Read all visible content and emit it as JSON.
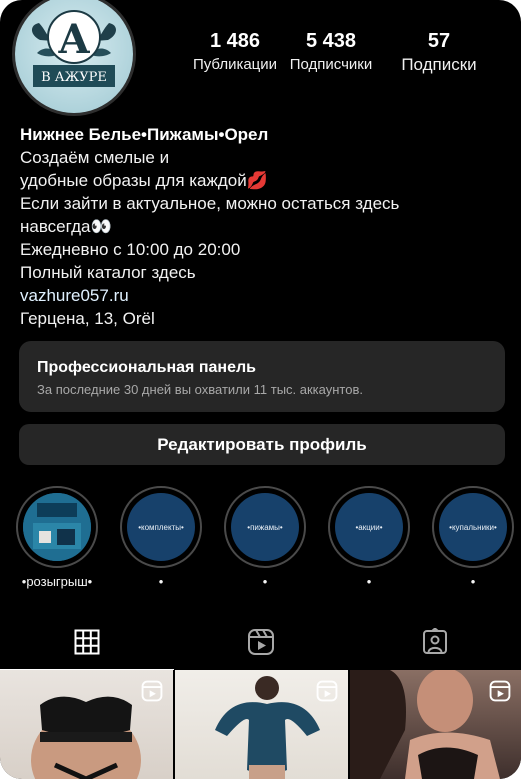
{
  "profile": {
    "logo_text": "В АЖУРЕ",
    "stats": [
      {
        "value": "1 486",
        "label": "Публикации"
      },
      {
        "value": "5 438",
        "label": "Подписчики"
      },
      {
        "value": "57",
        "label": "Подписки"
      }
    ],
    "bio": {
      "name": "Нижнее Белье•Пижамы•Орел",
      "line1": "Создаём смелые и",
      "line2": "удобные образы для каждой💋",
      "line3": "Если зайти в актуальное, можно остаться здесь",
      "line4": "навсегда👀",
      "line5": "Ежедневно с 10:00 до 20:00",
      "line6": "Полный каталог здесь",
      "link": "vazhure057.ru",
      "address": "Герцена, 13, Orël"
    }
  },
  "pro_panel": {
    "title": "Профессиональная панель",
    "subtitle": "За последние 30 дней вы охватили 11 тыс. аккаунтов."
  },
  "edit_button": "Редактировать профиль",
  "highlights": [
    {
      "caption": "•розыгрыш•",
      "cover_text": ""
    },
    {
      "caption": "•",
      "cover_text": "•комплекты•"
    },
    {
      "caption": "•",
      "cover_text": "•пижамы•"
    },
    {
      "caption": "•",
      "cover_text": "•акции•"
    },
    {
      "caption": "•",
      "cover_text": "•купальники•"
    }
  ],
  "tabs": [
    {
      "icon": "grid-icon"
    },
    {
      "icon": "reels-icon"
    },
    {
      "icon": "tagged-icon"
    }
  ],
  "grid_posts": [
    {
      "icon": "reel-icon"
    },
    {
      "icon": "reel-icon"
    },
    {
      "icon": "reel-icon"
    }
  ]
}
